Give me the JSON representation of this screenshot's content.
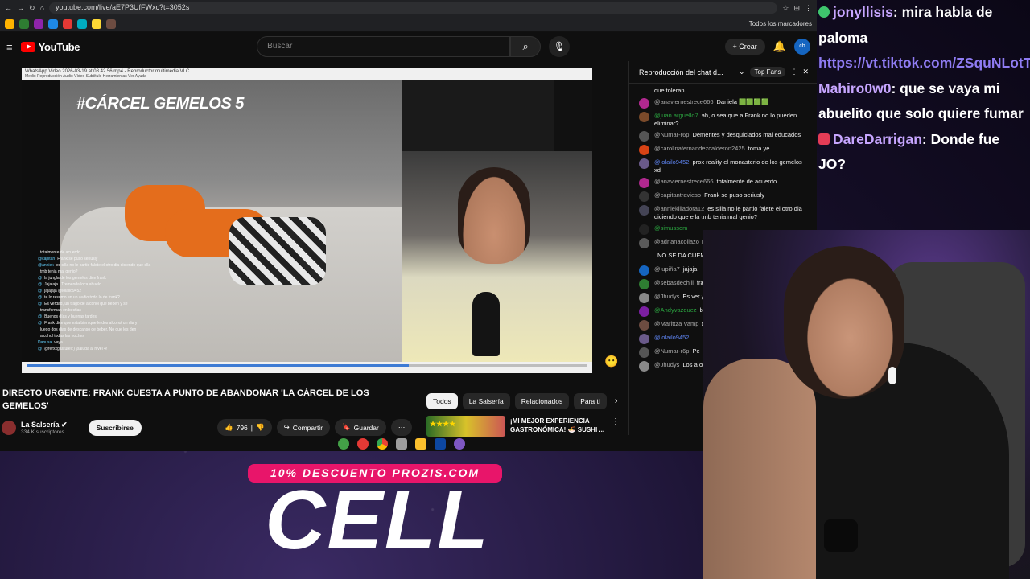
{
  "browser": {
    "url": "youtube.com/live/aE7P3UfFWxc?t=3052s",
    "bookmarks_label": "Todos los marcadores"
  },
  "youtube": {
    "logo_text": "YouTube",
    "search_placeholder": "Buscar",
    "create_label": "Crear",
    "avatar_text": "ch"
  },
  "video": {
    "vlc_title": "WhatsApp Video 2026-03-19 at 08.42.56.mp4 - Reproductor multimedia VLC",
    "vlc_menu": "Medio   Reproducción   Audio   Vídeo   Subtítulo   Herramientas   Ver   Ayuda",
    "show_tag": "#CÁRCEL GEMELOS 5",
    "overlay_chat": [
      {
        "user": "",
        "text": "totalmente de acuerdo"
      },
      {
        "user": "@capitan",
        "text": "Frank se puso seriusly"
      },
      {
        "user": "@anniek",
        "text": "es silla no le partio falete el otro dia diciendo que ella"
      },
      {
        "user": "",
        "text": "tmb tenia mal genio?"
      },
      {
        "user": "@",
        "text": "la jungla de los gemelos dice frank"
      },
      {
        "user": "@",
        "text": "Jajajaja...Tremenda loca abuelo"
      },
      {
        "user": "@",
        "text": "jajajaja @lolailo9452"
      },
      {
        "user": "@",
        "text": "te lo resumo en un audio todo lo de frank?"
      },
      {
        "user": "@",
        "text": "Es verdad, un trago de alcohol que beben y se"
      },
      {
        "user": "",
        "text": "transforman en bestias"
      },
      {
        "user": "@",
        "text": "Buenos días y buenas tardes"
      },
      {
        "user": "@",
        "text": "Frank dice que esta bien que le dos alcohol un dia y"
      },
      {
        "user": "",
        "text": "luego dos dias de descanso de beber. No que les den"
      },
      {
        "user": "",
        "text": "alcohol todas las noches"
      },
      {
        "user": "Danusa",
        "text": "vaya"
      },
      {
        "user": "@",
        "text": "@ferxxgasturell:) ¡saluda al nivel 4!"
      }
    ],
    "playback_progress": 0.67
  },
  "watch": {
    "title": "DIRECTO URGENTE: FRANK CUESTA A PUNTO DE ABANDONAR 'LA CÁRCEL DE LOS GEMELOS'",
    "chips": [
      "Todos",
      "La Salsería",
      "Relacionados",
      "Para ti"
    ],
    "channel_name": "La Salsería",
    "subscribers": "334 K suscriptores",
    "subscribe_label": "Suscribirse",
    "likes": "796",
    "share_label": "Compartir",
    "save_label": "Guardar",
    "recommended_title": "¡MI MEJOR EXPERIENCIA GASTRONÓMICA! 🍜 SUSHI ..."
  },
  "live_chat": {
    "header": "Reproducción del chat d...",
    "top_fans": "Top Fans",
    "partial_top": "que toleran",
    "messages": [
      {
        "user": "@anaviernestrece666",
        "text": "Daniela 🟩🟩🟩🟩",
        "color": "#b1288f",
        "name_class": ""
      },
      {
        "user": "@juan.arguello7",
        "text": "ah, o sea que a Frank no lo pueden eliminar?",
        "color": "#7a4a2a",
        "name_class": "green"
      },
      {
        "user": "@Numar-r6p",
        "text": "Dementes y desquiciados mal educados",
        "color": "#555",
        "name_class": ""
      },
      {
        "user": "@carolinafernandezcalderon2425",
        "text": "toma ye",
        "color": "#d84315",
        "name_class": ""
      },
      {
        "user": "@lolailo9452",
        "text": "prox reality el monasterio de los gemelos xd",
        "color": "#6a5a8a",
        "name_class": "mod"
      },
      {
        "user": "@anaviernestrece666",
        "text": "totalmente de acuerdo",
        "color": "#b1288f",
        "name_class": ""
      },
      {
        "user": "@capitantravieso",
        "text": "Frank se puso seriusly",
        "color": "#333",
        "name_class": ""
      },
      {
        "user": "@anniekilladora12",
        "text": "es silla no le partio falete el otro dia diciendo que ella tmb tenia mal genio?",
        "color": "#445",
        "name_class": ""
      },
      {
        "user": "@simussom",
        "text": "",
        "color": "#222",
        "name_class": "green"
      },
      {
        "user": "@adrianacollazo",
        "text": "METE CACA",
        "color": "#5a5a5a",
        "name_class": ""
      },
      {
        "user": "",
        "text": "NO SE DA CUEN",
        "color": "",
        "name_class": ""
      },
      {
        "user": "@lupiña7",
        "text": "jajaja",
        "color": "#1565c0",
        "name_class": ""
      },
      {
        "user": "@sebasdechill",
        "text": "frank?",
        "color": "#2e7d32",
        "name_class": ""
      },
      {
        "user": "@Jhudys",
        "text": "Es ver y se transformar",
        "color": "#888",
        "name_class": ""
      },
      {
        "user": "@Andyvazquez",
        "text": "bichitos para es",
        "color": "#7b1fa2",
        "name_class": "green"
      },
      {
        "user": "@Marittza Vamp",
        "text": "des alcohol un d de beber. No que",
        "color": "#6d4c41",
        "name_class": ""
      },
      {
        "user": "@lolailo9452",
        "text": "",
        "color": "#6a5a8a",
        "name_class": "mod"
      },
      {
        "user": "@Numar-r6p",
        "text": "Pe",
        "color": "#555",
        "name_class": ""
      },
      {
        "user": "@Jhudys",
        "text": "Los a comportan mej",
        "color": "#888",
        "name_class": ""
      }
    ]
  },
  "stream_chat": [
    {
      "nick": "jonyllisis",
      "text": ": mira habla de paloma",
      "badge": "green"
    },
    {
      "link": "https://vt.tiktok.com/ZSquNLotT/"
    },
    {
      "nick": "Mahiro0w0",
      "text": ": que se vaya mi abuelito que solo quiere fumar",
      "badge": ""
    },
    {
      "nick": "DareDarrigan",
      "text": ": Donde fue JO?",
      "badge": "red"
    }
  ],
  "promo": {
    "banner": "10% DESCUENTO PROZIS.COM",
    "word": "CELL"
  },
  "colors": {
    "yt_bg": "#0f0f0f",
    "yt_red": "#ff0000",
    "promo_pink": "#e8156a",
    "nick_purple": "#c7a6ff"
  }
}
